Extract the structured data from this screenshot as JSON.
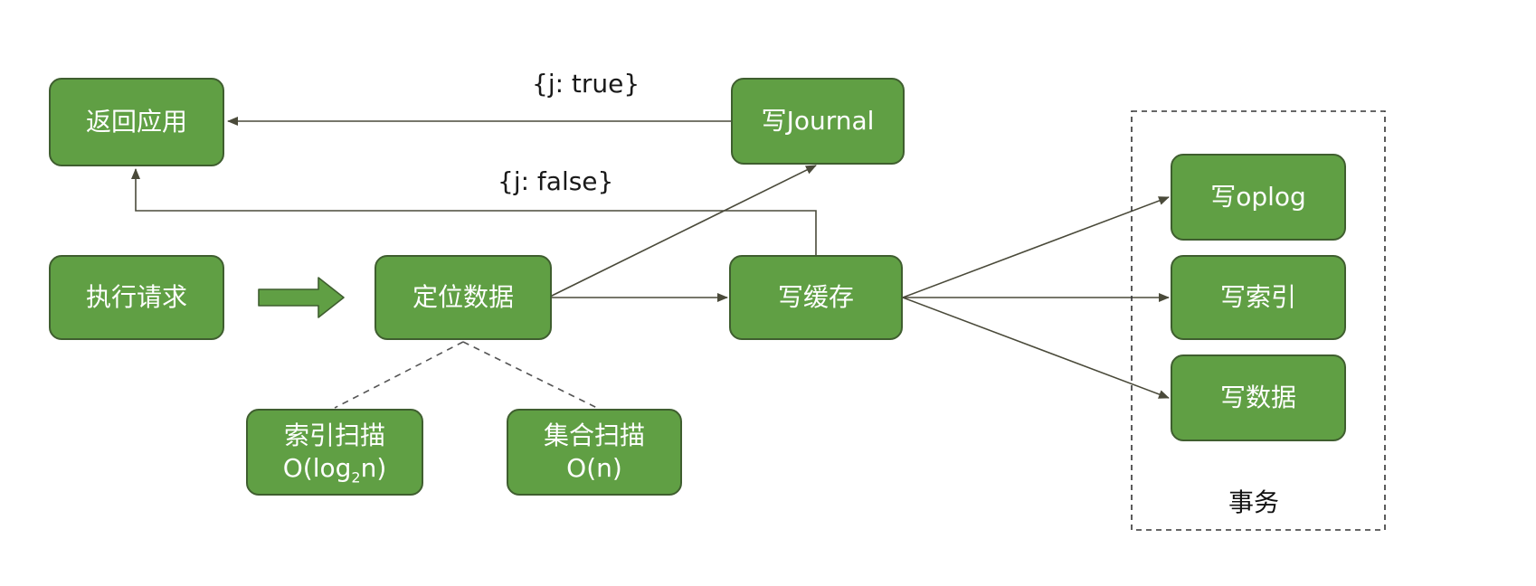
{
  "nodes": {
    "return_app": "返回应用",
    "write_journal": "写Journal",
    "execute_request": "执行请求",
    "locate_data": "定位数据",
    "write_cache": "写缓存",
    "index_scan": {
      "name": "索引扫描",
      "complexity_prefix": "O(log",
      "complexity_sub": "2",
      "complexity_suffix": "n)"
    },
    "collection_scan": {
      "name": "集合扫描",
      "complexity": "O(n)"
    },
    "write_oplog": "写oplog",
    "write_index": "写索引",
    "write_data": "写数据"
  },
  "edge_labels": {
    "j_true": "{j: true}",
    "j_false": "{j: false}"
  },
  "group": {
    "label": "事务"
  },
  "colors": {
    "node_fill": "#609f44",
    "node_border": "#3f5e2f",
    "line": "#4a4a3a",
    "dashed": "#555555"
  }
}
